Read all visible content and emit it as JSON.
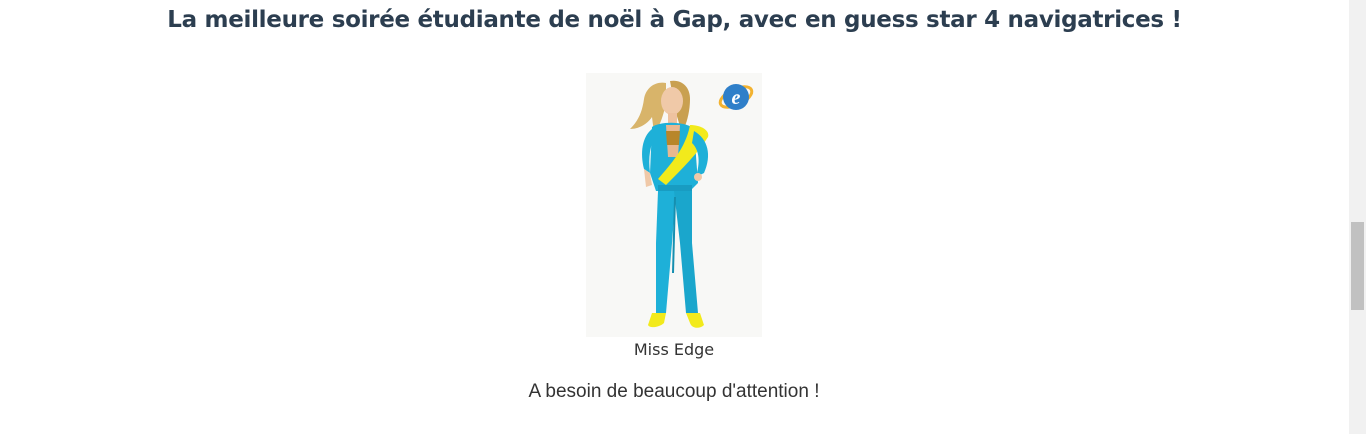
{
  "article": {
    "title": "La meilleure soirée étudiante de noël à Gap, avec en guess star 4 navigatrices !",
    "figure": {
      "caption": "Miss Edge",
      "badge_icon": "internet-explorer-logo-icon"
    },
    "description": "A besoin de beaucoup d'attention !"
  },
  "colors": {
    "title": "#2c3e50",
    "text": "#333333",
    "suit": "#1eb0d8",
    "scarf": "#f2ea1c",
    "scrollbar_track": "#f1f1f1",
    "scrollbar_thumb": "#c1c1c1"
  }
}
